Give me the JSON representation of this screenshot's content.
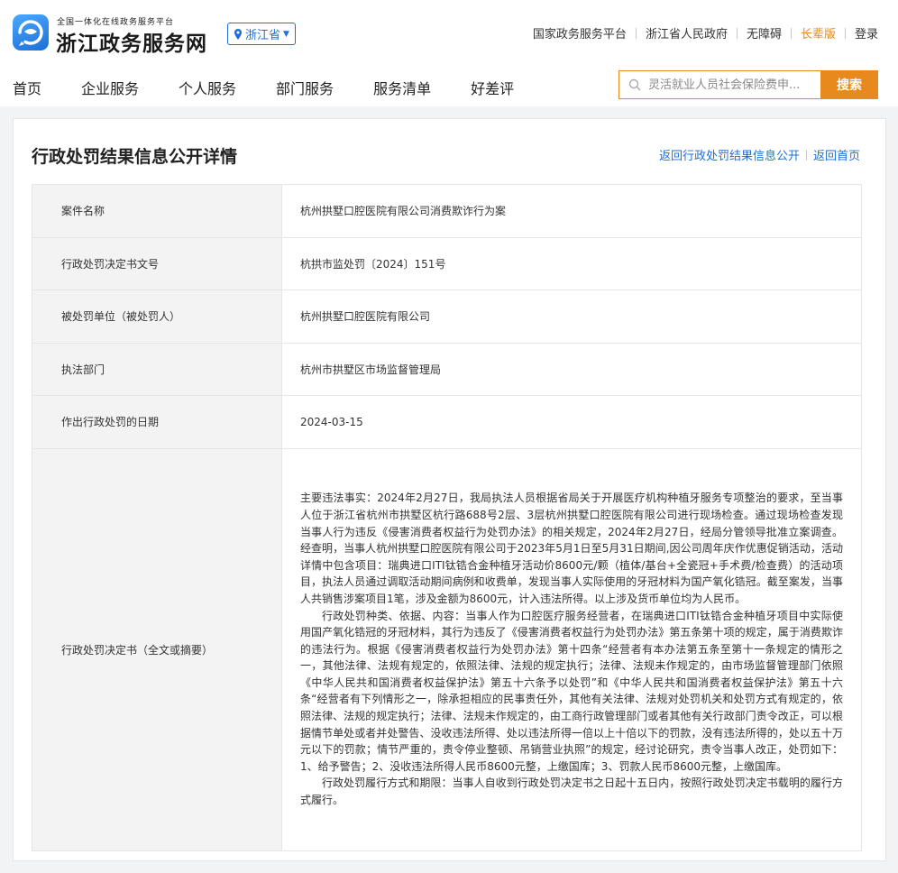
{
  "header": {
    "logo_small": "全国一体化在线政务服务平台",
    "logo_big": "浙江政务服务网",
    "region": "浙江省",
    "top_links": [
      "国家政务服务平台",
      "浙江省人民政府",
      "无障碍",
      "长辈版",
      "登录"
    ],
    "nav": [
      "首页",
      "企业服务",
      "个人服务",
      "部门服务",
      "服务清单",
      "好差评"
    ],
    "search_placeholder": "灵活就业人员社会保险费申...",
    "search_button": "搜索"
  },
  "colors": {
    "accent": "#1f6fd6",
    "search": "#e8891d"
  },
  "page": {
    "title": "行政处罚结果信息公开详情",
    "back_list": "返回行政处罚结果信息公开",
    "back_home": "返回首页"
  },
  "rows": [
    {
      "label": "案件名称",
      "value": "杭州拱墅口腔医院有限公司消费欺诈行为案"
    },
    {
      "label": "行政处罚决定书文号",
      "value": "杭拱市监处罚〔2024〕151号"
    },
    {
      "label": "被处罚单位（被处罚人）",
      "value": "杭州拱墅口腔医院有限公司"
    },
    {
      "label": "执法部门",
      "value": "杭州市拱墅区市场监督管理局"
    },
    {
      "label": "作出行政处罚的日期",
      "value": "2024-03-15"
    }
  ],
  "decision": {
    "label": "行政处罚决定书（全文或摘要）",
    "p1": "主要违法事实：2024年2月27日，我局执法人员根据省局关于开展医疗机构种植牙服务专项整治的要求，至当事人位于浙江省杭州市拱墅区杭行路688号2层、3层杭州拱墅口腔医院有限公司进行现场检查。通过现场检查发现当事人行为违反《侵害消费者权益行为处罚办法》的相关规定，2024年2月27日，经局分管领导批准立案调查。经查明，当事人杭州拱墅口腔医院有限公司于2023年5月1日至5月31日期间,因公司周年庆作优惠促销活动，活动详情中包含项目：瑞典进口ITI钛锆合金种植牙活动价8600元/颗（植体/基台+全瓷冠+手术费/检查费）的活动项目，执法人员通过调取活动期间病例和收费单，发现当事人实际使用的牙冠材料为国产氧化锆冠。截至案发，当事人共销售涉案项目1笔，涉及金额为8600元，计入违法所得。以上涉及货币单位均为人民币。",
    "p2": "行政处罚种类、依据、内容：当事人作为口腔医疗服务经营者，在瑞典进口ITI钛锆合金种植牙项目中实际使用国产氧化锆冠的牙冠材料，其行为违反了《侵害消费者权益行为处罚办法》第五条第十项的规定，属于消费欺诈的违法行为。根据《侵害消费者权益行为处罚办法》第十四条“经营者有本办法第五条至第十一条规定的情形之一，其他法律、法规有规定的，依照法律、法规的规定执行；法律、法规未作规定的，由市场监督管理部门依照《中华人民共和国消费者权益保护法》第五十六条予以处罚”和《中华人民共和国消费者权益保护法》第五十六条“经营者有下列情形之一，除承担相应的民事责任外，其他有关法律、法规对处罚机关和处罚方式有规定的，依照法律、法规的规定执行；法律、法规未作规定的，由工商行政管理部门或者其他有关行政部门责令改正，可以根据情节单处或者并处警告、没收违法所得、处以违法所得一倍以上十倍以下的罚款，没有违法所得的，处以五十万元以下的罚款；情节严重的，责令停业整顿、吊销营业执照”的规定，经讨论研究，责令当事人改正，处罚如下：1、给予警告；2、没收违法所得人民币8600元整，上缴国库；3、罚款人民币8600元整，上缴国库。",
    "p3": "行政处罚履行方式和期限：当事人自收到行政处罚决定书之日起十五日内，按照行政处罚决定书载明的履行方式履行。"
  }
}
